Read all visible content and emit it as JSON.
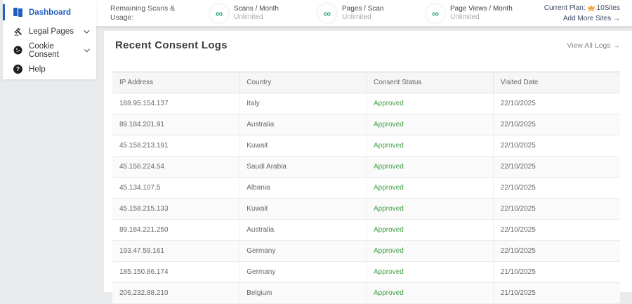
{
  "sidebar": {
    "items": [
      {
        "label": "Dashboard",
        "icon": "dashboard-icon",
        "active": true
      },
      {
        "label": "Legal Pages",
        "icon": "gavel-icon",
        "expandable": true
      },
      {
        "label": "Cookie Consent",
        "icon": "cookie-icon",
        "expandable": true
      },
      {
        "label": "Help",
        "icon": "help-icon"
      }
    ]
  },
  "topbar": {
    "usage_label": "Remaining Scans & Usage:",
    "infinity_symbol": "∞",
    "stats": [
      {
        "label": "Scans / Month",
        "value": "Unlimited"
      },
      {
        "label": "Pages / Scan",
        "value": "Unlimited"
      },
      {
        "label": "Page Views / Month",
        "value": "Unlimited"
      }
    ],
    "plan": {
      "label": "Current Plan:",
      "icon": "crown-icon",
      "value": "10Sites"
    },
    "add_more_sites": "Add More Sites →"
  },
  "main": {
    "title": "Recent Consent Logs",
    "view_all": "View All Logs →",
    "table": {
      "columns": [
        "IP Address",
        "Country",
        "Consent Status",
        "Visited Date"
      ],
      "rows": [
        [
          "188.95.154.137",
          "Italy",
          "Approved",
          "22/10/2025"
        ],
        [
          "89.184.201.91",
          "Australia",
          "Approved",
          "22/10/2025"
        ],
        [
          "45.158.213.191",
          "Kuwait",
          "Approved",
          "22/10/2025"
        ],
        [
          "45.156.224.54",
          "Saudi Arabia",
          "Approved",
          "22/10/2025"
        ],
        [
          "45.134.107.5",
          "Albania",
          "Approved",
          "22/10/2025"
        ],
        [
          "45.158.215.133",
          "Kuwait",
          "Approved",
          "22/10/2025"
        ],
        [
          "89.184.221.250",
          "Australia",
          "Approved",
          "22/10/2025"
        ],
        [
          "193.47.59.161",
          "Germany",
          "Approved",
          "22/10/2025"
        ],
        [
          "185.150.86.174",
          "Germany",
          "Approved",
          "21/10/2025"
        ],
        [
          "206.232.88.210",
          "Belgium",
          "Approved",
          "21/10/2025"
        ]
      ]
    }
  },
  "colors": {
    "active_blue": "#2060c0",
    "approved_green": "#43a047",
    "infinity_green": "#2aa17c",
    "crown_orange": "#f2a33c",
    "plan_navy": "#3f4b66",
    "page_bg": "#e9eaec"
  }
}
